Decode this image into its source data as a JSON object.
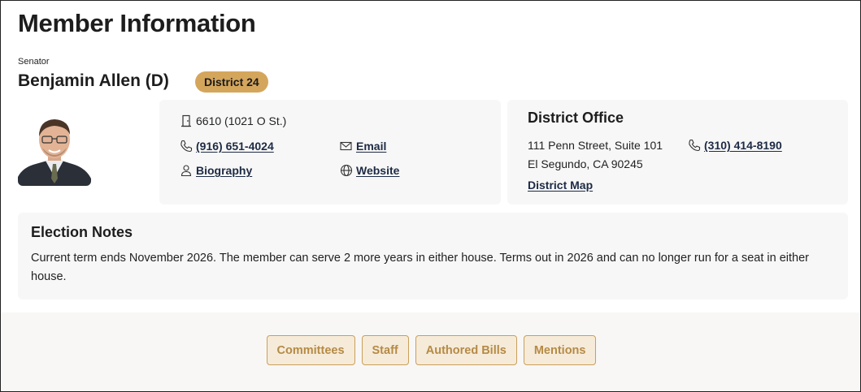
{
  "page": {
    "title": "Member Information"
  },
  "member": {
    "role": "Senator",
    "name": "Benjamin Allen (D)",
    "district_badge": "District 24"
  },
  "capitol_office": {
    "room": "6610 (1021 O St.)",
    "phone": "(916) 651-4024",
    "email_label": "Email",
    "biography_label": "Biography",
    "website_label": "Website"
  },
  "district_office": {
    "heading": "District Office",
    "address_line1": "111 Penn Street, Suite 101",
    "address_line2": "El Segundo, CA 90245",
    "phone": "(310) 414-8190",
    "map_label": "District Map"
  },
  "election_notes": {
    "heading": "Election Notes",
    "text": "Current term ends November 2026. The member can serve 2 more years in either house. Terms out in 2026 and can no longer run for a seat in either house."
  },
  "tabs": [
    {
      "label": "Committees"
    },
    {
      "label": "Staff"
    },
    {
      "label": "Authored Bills"
    },
    {
      "label": "Mentions"
    }
  ],
  "colors": {
    "badge": "#d4a65c",
    "tab_fill": "#f6ebd9",
    "tab_text": "#b58a45",
    "card_bg": "#f7f7f7"
  },
  "icons": {
    "room": "door-icon",
    "phone": "phone-icon",
    "email": "envelope-icon",
    "biography": "person-icon",
    "website": "globe-icon"
  }
}
